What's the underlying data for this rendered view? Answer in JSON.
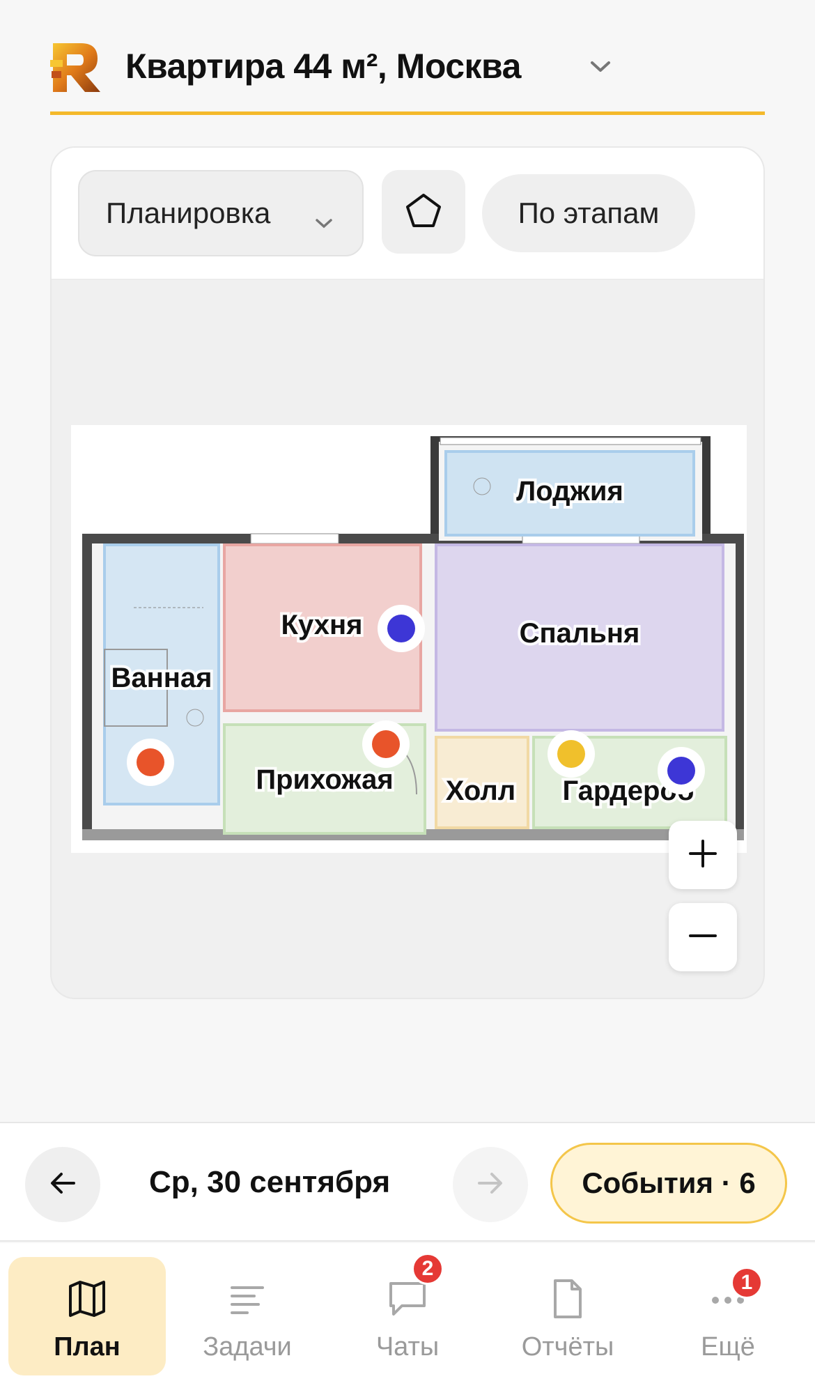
{
  "header": {
    "title": "Квартира 44 м², Москва",
    "logo_icon": "brand-logo-icon",
    "accent_color": "#f4b92b"
  },
  "toolbar": {
    "layout_label": "Планировка",
    "shape_icon": "pentagon-icon",
    "stages_label": "По этапам"
  },
  "plan": {
    "rooms": [
      {
        "label": "Лоджия",
        "color": "#cfe3f2"
      },
      {
        "label": "Кухня",
        "color": "#f2cfcd"
      },
      {
        "label": "Спальня",
        "color": "#ddd6ee"
      },
      {
        "label": "Ванная",
        "color": "#d5e6f3"
      },
      {
        "label": "Прихожая",
        "color": "#e3efdc"
      },
      {
        "label": "Холл",
        "color": "#f8ecd3"
      },
      {
        "label": "Гардероб",
        "color": "#e3efdc"
      }
    ],
    "markers": [
      {
        "room": "Кухня",
        "color": "#3d36d6"
      },
      {
        "room": "Ванная",
        "color": "#e8542a"
      },
      {
        "room": "Прихожая",
        "color": "#e8542a"
      },
      {
        "room": "Гардероб",
        "color": "#f0c02c"
      },
      {
        "room": "Гардероб",
        "color": "#3d36d6"
      }
    ],
    "zoom_in": "+",
    "zoom_out": "−"
  },
  "datebar": {
    "date": "Ср, 30 сентября",
    "prev_icon": "arrow-left-icon",
    "next_icon": "arrow-right-icon",
    "events_label": "События · 6"
  },
  "tabs": [
    {
      "label": "План",
      "icon": "map-icon",
      "active": true
    },
    {
      "label": "Задачи",
      "icon": "list-icon"
    },
    {
      "label": "Чаты",
      "icon": "chat-icon",
      "badge": "2"
    },
    {
      "label": "Отчёты",
      "icon": "document-icon"
    },
    {
      "label": "Ещё",
      "icon": "more-icon",
      "badge": "1"
    }
  ]
}
